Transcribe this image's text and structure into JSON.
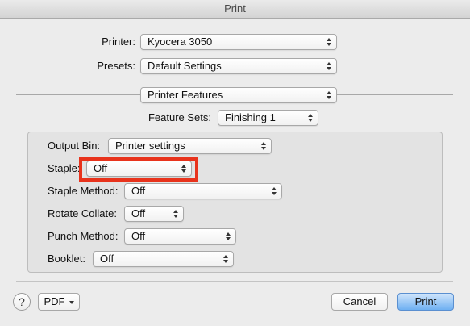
{
  "window": {
    "title": "Print"
  },
  "printer": {
    "label": "Printer:",
    "value": "Kyocera 3050"
  },
  "presets": {
    "label": "Presets:",
    "value": "Default Settings"
  },
  "panel": {
    "value": "Printer Features"
  },
  "feature_sets": {
    "label": "Feature Sets:",
    "value": "Finishing 1"
  },
  "options": {
    "output_bin": {
      "label": "Output Bin:",
      "value": "Printer settings"
    },
    "staple": {
      "label": "Staple:",
      "value": "Off"
    },
    "staple_method": {
      "label": "Staple Method:",
      "value": "Off"
    },
    "rotate_collate": {
      "label": "Rotate Collate:",
      "value": "Off"
    },
    "punch_method": {
      "label": "Punch Method:",
      "value": "Off"
    },
    "booklet": {
      "label": "Booklet:",
      "value": "Off"
    }
  },
  "footer": {
    "help_label": "?",
    "pdf_label": "PDF",
    "cancel_label": "Cancel",
    "print_label": "Print"
  },
  "colors": {
    "highlight": "#e8331c",
    "default_button": "#6fb0f2"
  }
}
